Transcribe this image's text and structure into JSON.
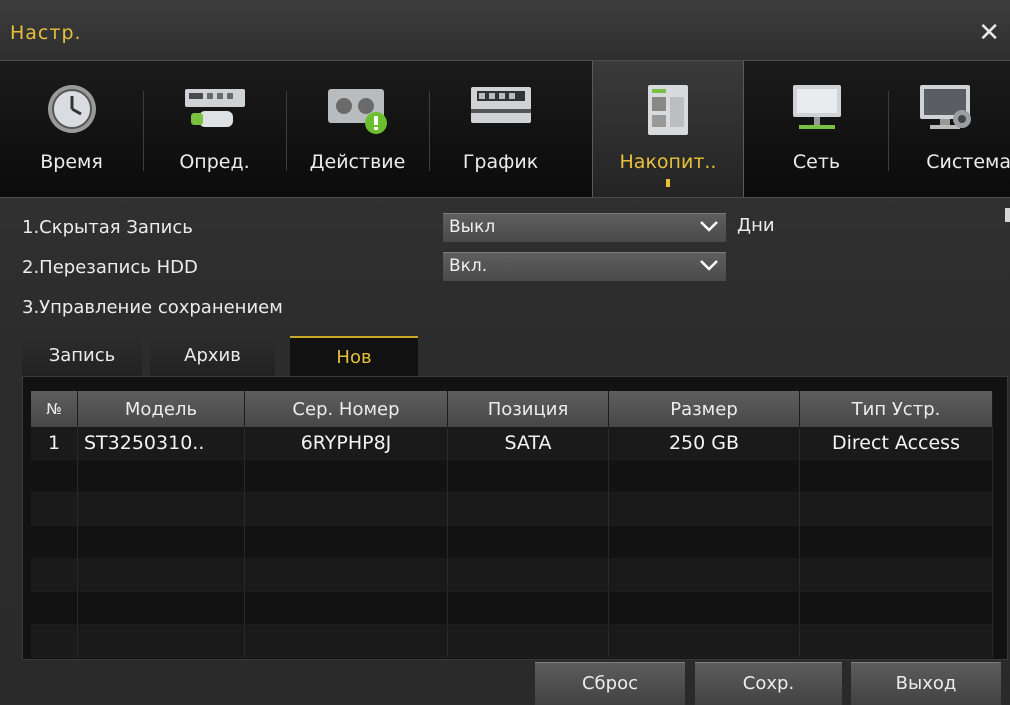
{
  "window": {
    "title": "Настр.",
    "close_glyph": "✕"
  },
  "tabs": [
    {
      "label": "Время",
      "icon": "clock-icon"
    },
    {
      "label": "Опред.",
      "icon": "camera-device-icon"
    },
    {
      "label": "Действие",
      "icon": "action-alert-icon"
    },
    {
      "label": "График",
      "icon": "schedule-icon"
    },
    {
      "label": "Накопит..",
      "icon": "storage-icon",
      "active": true
    },
    {
      "label": "Сеть",
      "icon": "network-monitor-icon"
    },
    {
      "label": "Система",
      "icon": "system-settings-icon"
    }
  ],
  "settings": {
    "hidden_record": {
      "label": "1.Скрытая Запись",
      "value": "Выкл",
      "unit": "Дни"
    },
    "hdd_overwrite": {
      "label": "2.Перезапись HDD",
      "value": "Вкл."
    },
    "storage_mgmt": {
      "label": "3.Управление сохранением"
    }
  },
  "subtabs": [
    {
      "label": "Запись"
    },
    {
      "label": "Архив"
    },
    {
      "label": "Нов",
      "active": true
    }
  ],
  "table": {
    "columns": [
      "№",
      "Модель",
      "Сер. Номер",
      "Позиция",
      "Размер",
      "Тип Устр."
    ],
    "rows": [
      [
        "1",
        "ST3250310..",
        "6RYPHP8J",
        "SATA",
        "250 GB",
        "Direct Access"
      ]
    ]
  },
  "buttons": {
    "reset": "Сброс",
    "save": "Сохр.",
    "exit": "Выход"
  },
  "colors": {
    "accent": "#e8c13a",
    "background": "#2b2b2b"
  }
}
